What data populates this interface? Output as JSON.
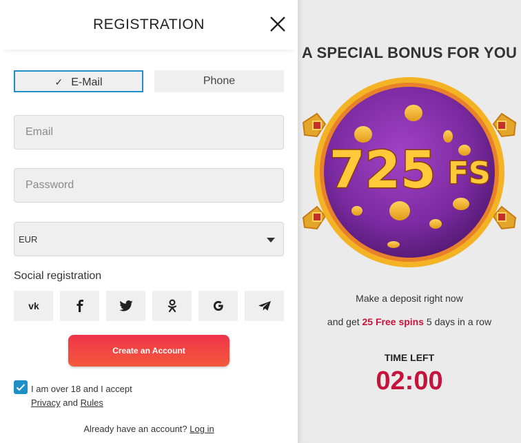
{
  "modal": {
    "title": "REGISTRATION",
    "tabs": {
      "email": "E-Mail",
      "phone": "Phone"
    },
    "email_placeholder": "Email",
    "password_placeholder": "Password",
    "currency_selected": "EUR",
    "social_label": "Social registration",
    "social_icons": [
      "vk-icon",
      "facebook-icon",
      "twitter-icon",
      "odnoklassniki-icon",
      "google-icon",
      "telegram-icon"
    ],
    "create_button": "Create an Account",
    "agree_text": "I am over 18 and I accept",
    "privacy_link": "Privacy",
    "and_text": "and",
    "rules_link": "Rules",
    "already_text": "Already have an account?",
    "login_link": "Log in"
  },
  "bonus": {
    "title": "A SPECIAL BONUS FOR YOU",
    "medal_number": "725",
    "medal_suffix": "FS",
    "line1": "Make a deposit right now",
    "line2_prefix": "and get",
    "line2_highlight": "25 Free spins",
    "line2_suffix": "5 days in a row",
    "time_left_label": "TIME LEFT",
    "timer": "02:00"
  },
  "colors": {
    "accent_blue": "#1f8fc7",
    "cta_red": "#f0334b",
    "highlight_red": "#c4143c",
    "medal_purple": "#7a2aa0",
    "medal_gold": "#f3b324"
  }
}
